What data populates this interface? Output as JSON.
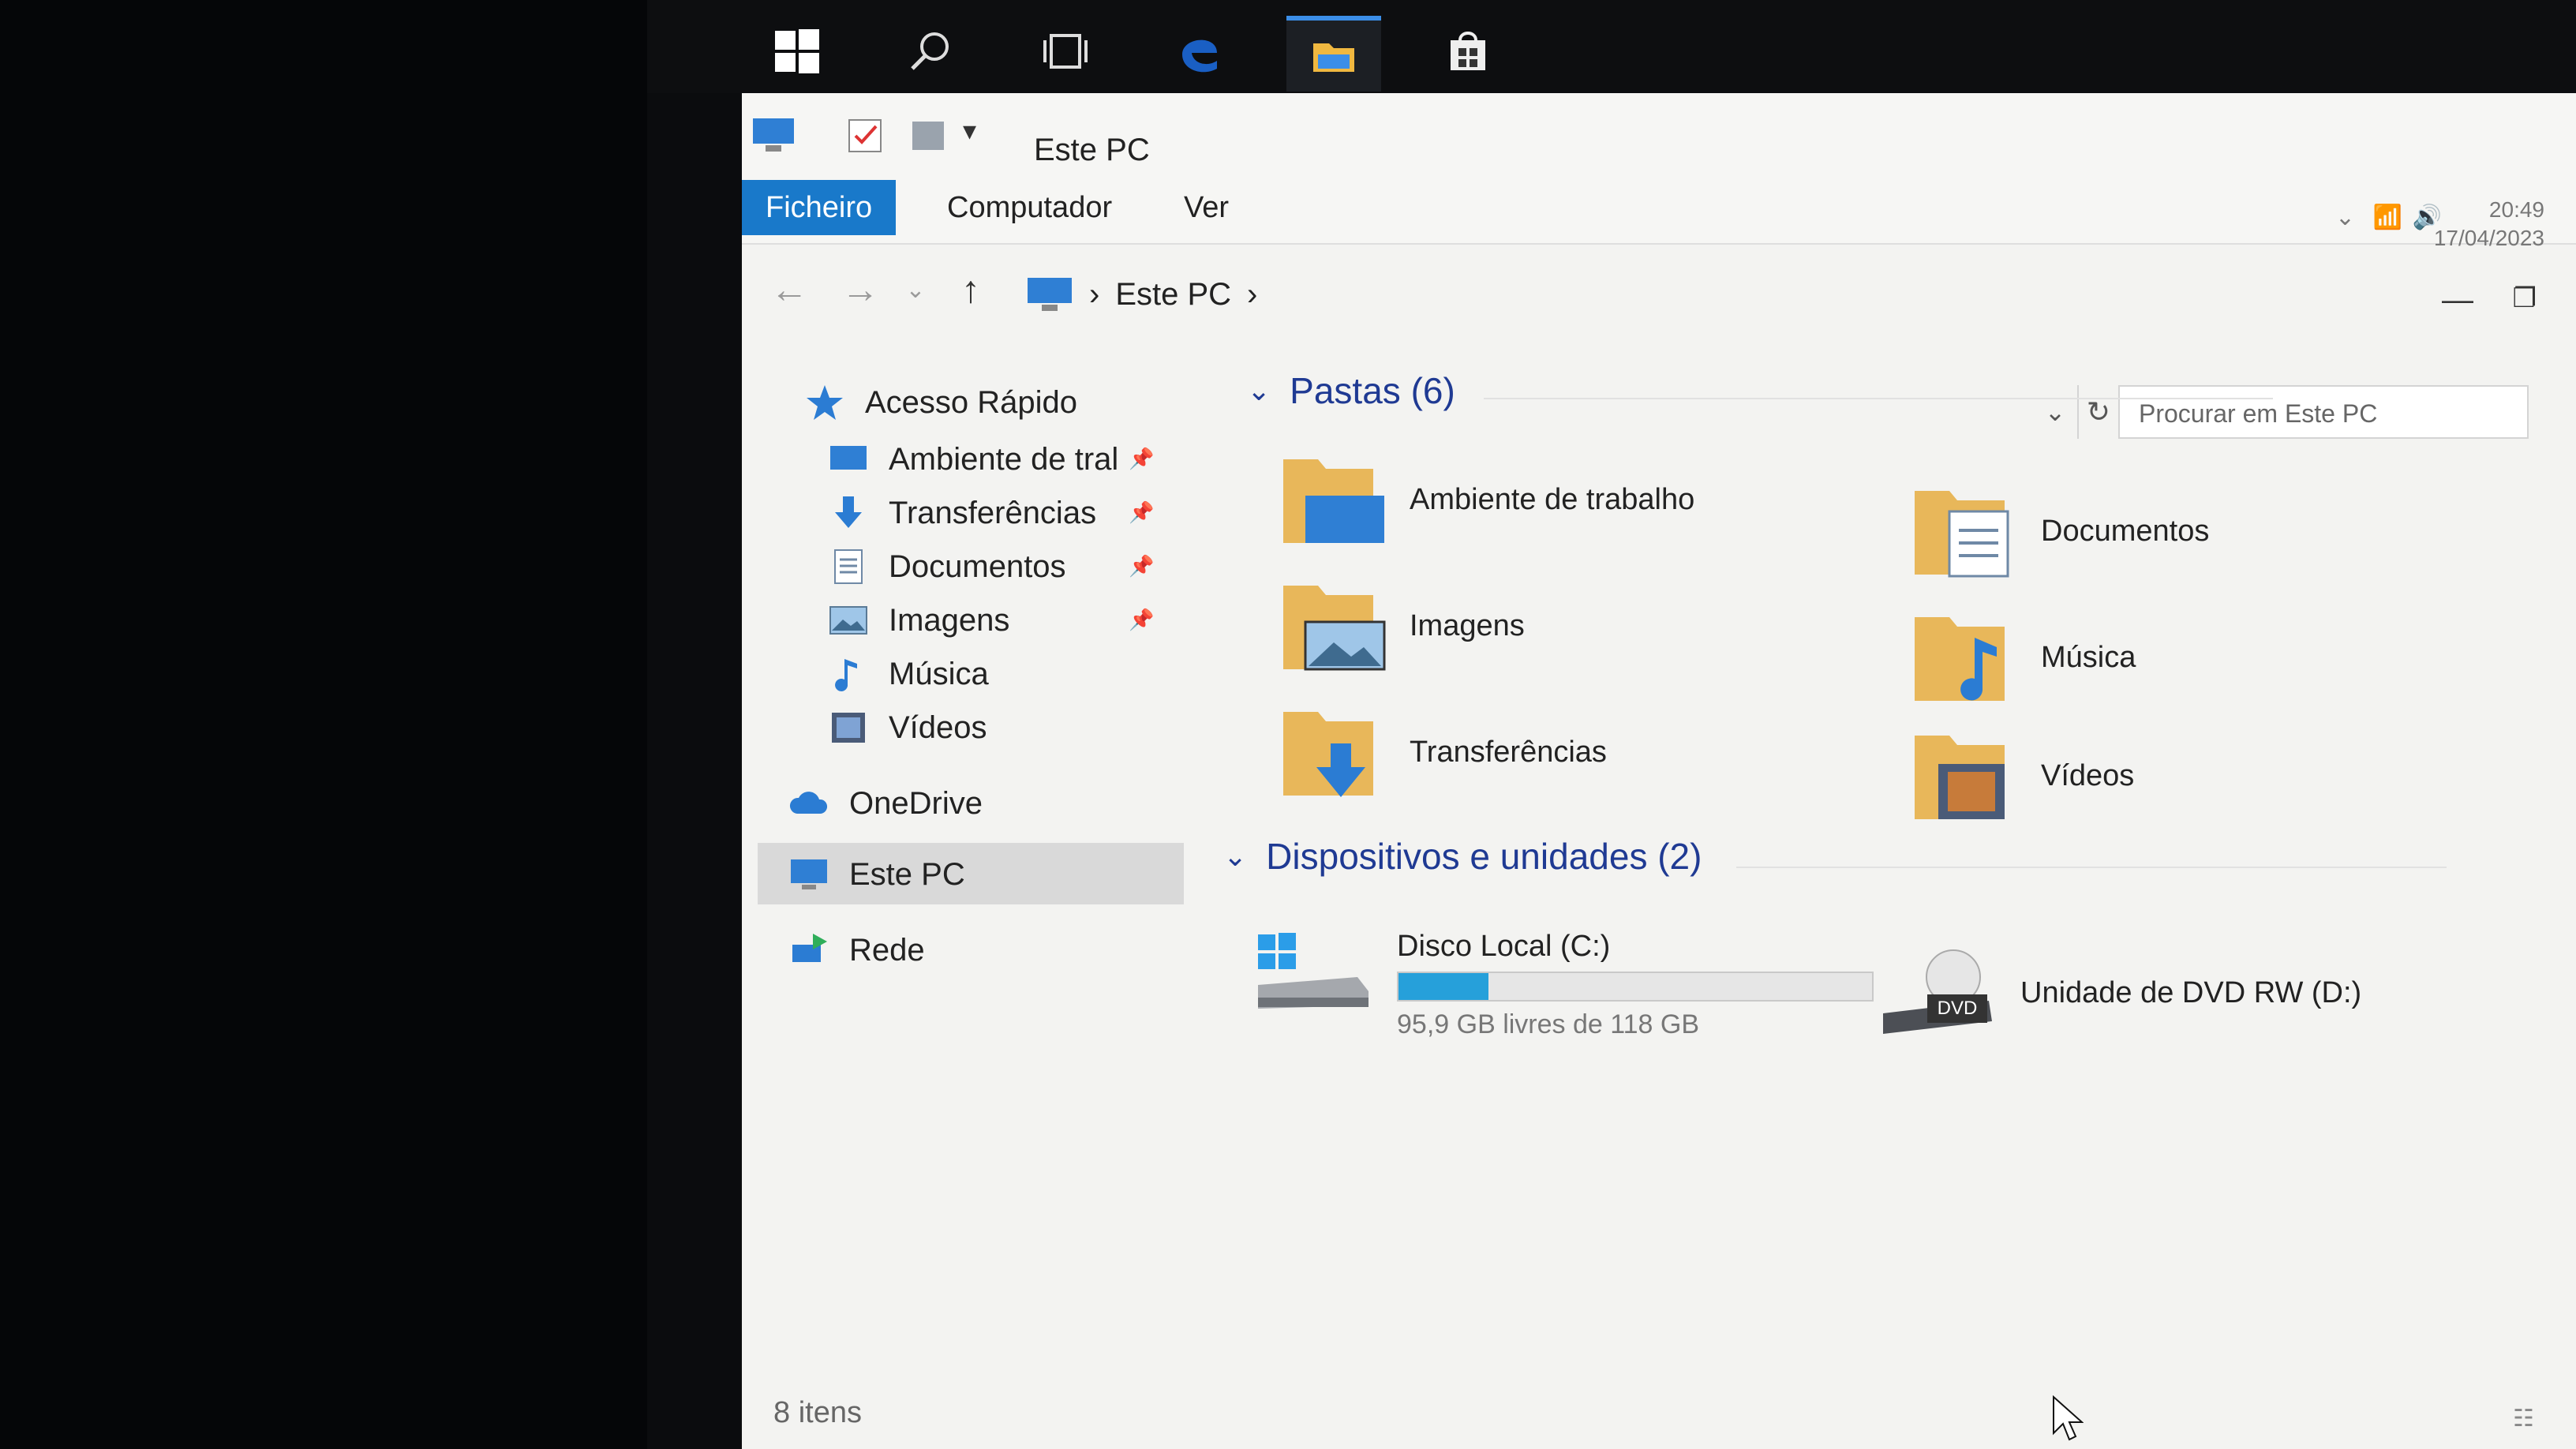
{
  "taskbar": {
    "icons": [
      "windows-start-icon",
      "search-icon",
      "task-view-icon",
      "edge-icon",
      "file-explorer-icon",
      "store-icon"
    ],
    "clock_time": "20:49",
    "clock_date": "17/04/2023"
  },
  "window": {
    "title": "Este PC",
    "ribbon_tabs": [
      "Ficheiro",
      "Computador",
      "Ver"
    ],
    "breadcrumb": [
      "Este PC"
    ],
    "search_placeholder": "Procurar em Este PC"
  },
  "nav_pane": {
    "quick_access": "Acesso Rápido",
    "pinned": [
      {
        "label": "Ambiente de tral",
        "icon": "desktop-icon",
        "pinned": true
      },
      {
        "label": "Transferências",
        "icon": "downloads-icon",
        "pinned": true
      },
      {
        "label": "Documentos",
        "icon": "documents-icon",
        "pinned": true
      },
      {
        "label": "Imagens",
        "icon": "pictures-icon",
        "pinned": true
      },
      {
        "label": "Música",
        "icon": "music-icon",
        "pinned": false
      },
      {
        "label": "Vídeos",
        "icon": "videos-icon",
        "pinned": false
      }
    ],
    "onedrive": "OneDrive",
    "this_pc": "Este PC",
    "network": "Rede"
  },
  "content": {
    "folders_header": "Pastas (6)",
    "folders": [
      {
        "label": "Ambiente de trabalho",
        "icon": "desktop-folder-icon"
      },
      {
        "label": "Documentos",
        "icon": "documents-folder-icon"
      },
      {
        "label": "Imagens",
        "icon": "pictures-folder-icon"
      },
      {
        "label": "Música",
        "icon": "music-folder-icon"
      },
      {
        "label": "Transferências",
        "icon": "downloads-folder-icon"
      },
      {
        "label": "Vídeos",
        "icon": "videos-folder-icon"
      }
    ],
    "devices_header": "Dispositivos e unidades (2)",
    "drives": [
      {
        "label": "Disco Local (C:)",
        "free_text": "95,9 GB livres de 118 GB",
        "used_fraction": 0.19
      },
      {
        "label": "Unidade de DVD RW (D:)",
        "badge": "DVD"
      }
    ]
  },
  "status_bar": {
    "item_count": "8 itens"
  },
  "colors": {
    "accent": "#1979ca",
    "group_header": "#1f3a93",
    "folder": "#e8b75a",
    "drive_bar": "#26a0da"
  }
}
